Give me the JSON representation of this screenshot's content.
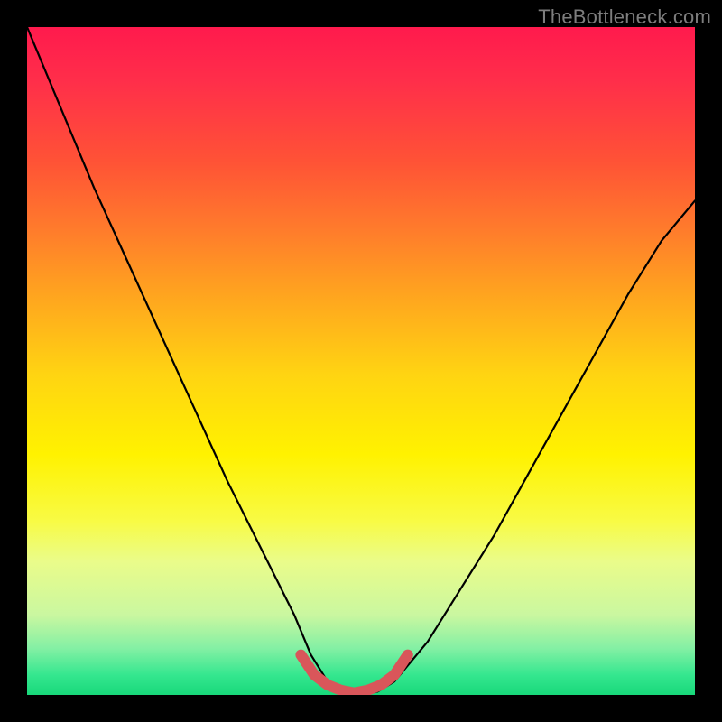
{
  "watermark": "TheBottleneck.com",
  "chart_data": {
    "type": "line",
    "title": "",
    "xlabel": "",
    "ylabel": "",
    "xlim": [
      0,
      100
    ],
    "ylim": [
      0,
      100
    ],
    "series": [
      {
        "name": "bottleneck-curve",
        "x": [
          0,
          5,
          10,
          15,
          20,
          25,
          30,
          35,
          40,
          42.5,
          45,
          47.5,
          50,
          52.5,
          55,
          60,
          65,
          70,
          75,
          80,
          85,
          90,
          95,
          100
        ],
        "values": [
          100,
          88,
          76,
          65,
          54,
          43,
          32,
          22,
          12,
          6,
          2,
          0.5,
          0,
          0.5,
          2,
          8,
          16,
          24,
          33,
          42,
          51,
          60,
          68,
          74
        ]
      },
      {
        "name": "highlight-segment",
        "x": [
          41,
          43,
          45,
          47,
          49,
          51,
          53,
          55,
          57
        ],
        "values": [
          6,
          3,
          1.5,
          0.7,
          0.3,
          0.7,
          1.5,
          3,
          6
        ]
      }
    ],
    "gradient_stops": [
      {
        "pct": 0,
        "color": "#ff1a4d"
      },
      {
        "pct": 20,
        "color": "#ff5236"
      },
      {
        "pct": 40,
        "color": "#ffa41f"
      },
      {
        "pct": 64,
        "color": "#fff200"
      },
      {
        "pct": 88,
        "color": "#caf7a0"
      },
      {
        "pct": 100,
        "color": "#18d87a"
      }
    ]
  }
}
